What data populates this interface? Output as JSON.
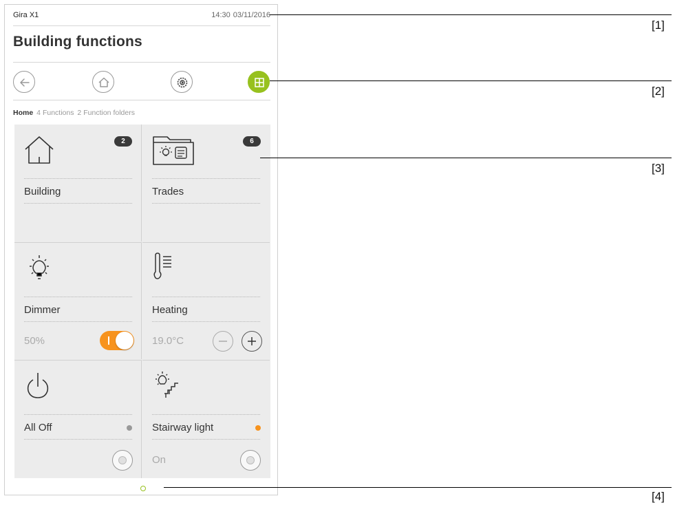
{
  "status": {
    "device_name": "Gira X1",
    "time": "14:30",
    "date": "03/11/2016"
  },
  "page_title": "Building functions",
  "breadcrumb": {
    "home": "Home",
    "functions_count": "4",
    "functions_label": "Functions",
    "folders_count": "2",
    "folders_label": "Function folders"
  },
  "nav": {
    "back_icon": "arrow-left-icon",
    "home_icon": "home-icon",
    "settings_icon": "gear-icon",
    "apps_icon": "grid-icon",
    "active_color": "#97c11f"
  },
  "tiles": [
    {
      "label": "Building",
      "icon": "house-icon",
      "badge": "2"
    },
    {
      "label": "Trades",
      "icon": "folder-icon",
      "badge": "6"
    },
    {
      "label": "Dimmer",
      "icon": "bulb-icon",
      "value": "50%",
      "state": "on",
      "accent": "#f7931e"
    },
    {
      "label": "Heating",
      "icon": "thermometer-icon",
      "value": "19.0°C"
    },
    {
      "label": "All Off",
      "icon": "power-icon",
      "status_color": "#999999"
    },
    {
      "label": "Stairway light",
      "icon": "stairway-light-icon",
      "value": "On",
      "status_color": "#f7931e"
    }
  ],
  "callouts": [
    "[1]",
    "[2]",
    "[3]",
    "[4]"
  ]
}
